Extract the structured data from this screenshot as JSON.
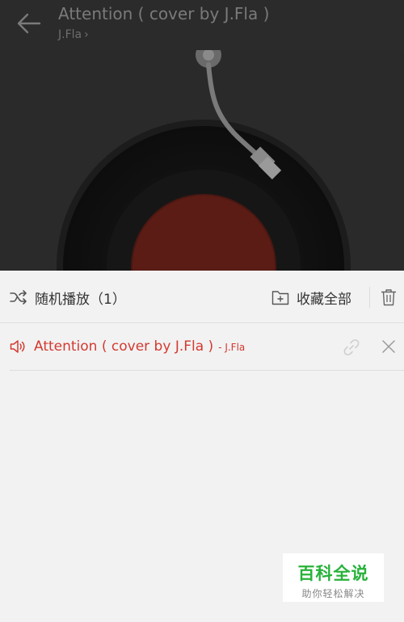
{
  "player": {
    "title": "Attention ( cover by J.Fla )",
    "artist": "J.Fla",
    "artist_chevron": "›",
    "back_icon": "arrow-left-icon"
  },
  "playlist": {
    "shuffle_label": "随机播放（1）",
    "collect_label": "收藏全部",
    "items": [
      {
        "title": "Attention ( cover by J.Fla )",
        "artist": "- J.Fla",
        "playing": true
      }
    ]
  },
  "watermark": {
    "main": "百科全说",
    "sub": "助你轻松解决"
  },
  "colors": {
    "accent": "#d33a31",
    "watermark_green": "#27b23a",
    "overlay": "#2a2a2a"
  }
}
